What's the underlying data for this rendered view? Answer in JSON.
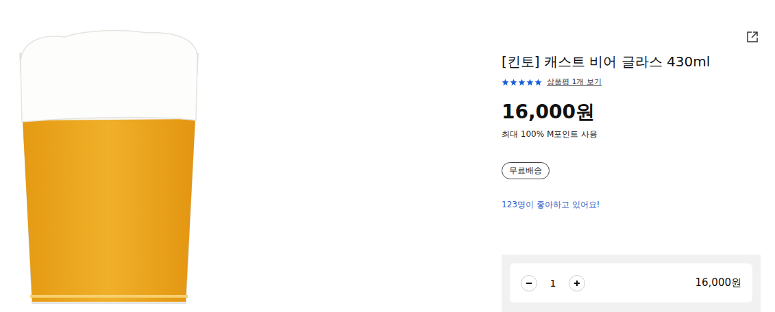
{
  "product": {
    "title": "[킨토] 캐스트 비어 글라스 430ml",
    "stars": 5,
    "review_link": "상품평 1개 보기",
    "price": "16,000원",
    "points_note": "최대 100% M포인트 사용",
    "badges": [
      "무료배송"
    ],
    "likes": "123명이 좋아하고 있어요!"
  },
  "quantity": {
    "value": "1",
    "total": "16,000원"
  }
}
